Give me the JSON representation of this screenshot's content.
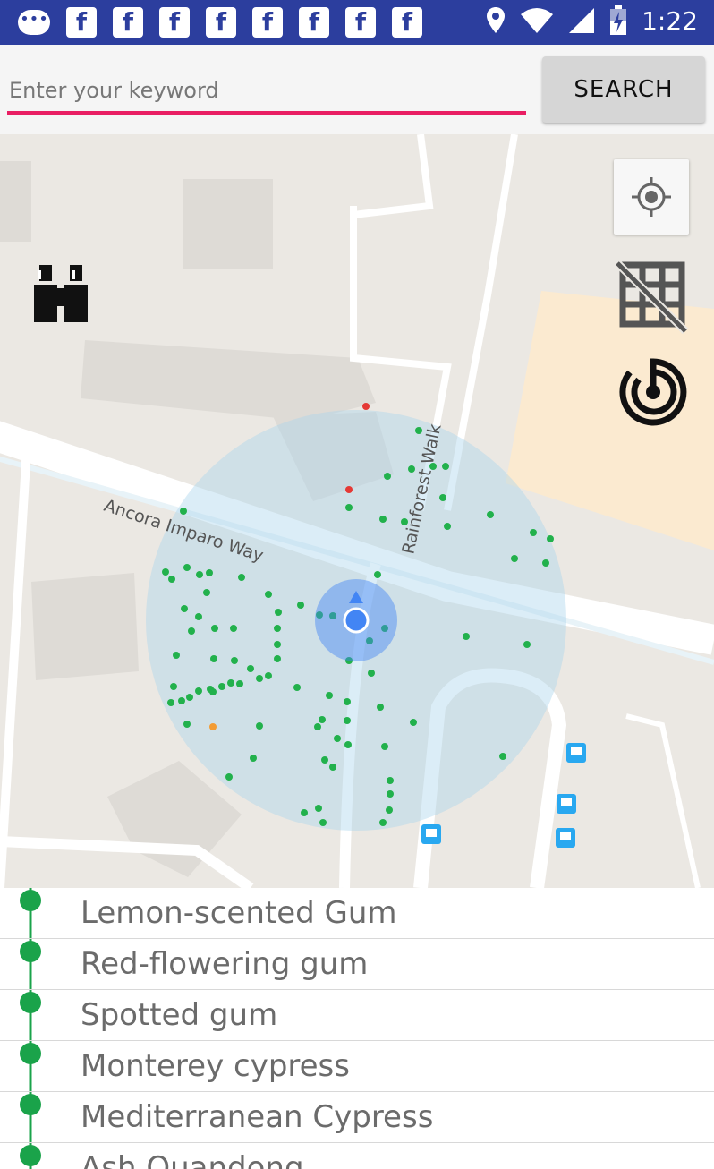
{
  "status_bar": {
    "icons": [
      "message-icon",
      "facebook-icon",
      "facebook-icon",
      "facebook-icon",
      "facebook-icon",
      "facebook-icon",
      "facebook-icon",
      "facebook-icon",
      "facebook-icon"
    ],
    "right_icons": [
      "location-icon",
      "wifi-icon",
      "signal-icon",
      "battery-icon"
    ],
    "time": "1:22",
    "fb_glyph": "f",
    "msg_glyph": "•••"
  },
  "search": {
    "placeholder": "Enter your keyword",
    "value": "",
    "button_label": "SEARCH"
  },
  "map": {
    "street_labels": [
      "Ancora Imparo Way",
      "Rainforest Walk"
    ],
    "controls": [
      "my-location-button",
      "grid-toggle-button",
      "radar-button",
      "binoculars-button"
    ],
    "colors": {
      "tree_dot": "#22b14c",
      "highlight_dot_red": "#e53935",
      "highlight_dot_orange": "#f39c34",
      "search_radius": "#a9d4ec",
      "user_location": "#4285f4"
    }
  },
  "list": {
    "items": [
      {
        "label": "Lemon-scented Gum"
      },
      {
        "label": "Red-flowering gum"
      },
      {
        "label": "Spotted gum"
      },
      {
        "label": "Monterey cypress"
      },
      {
        "label": "Mediterranean Cypress"
      },
      {
        "label": "Ash Quandong"
      }
    ],
    "pin_color": "#1aa34a"
  }
}
